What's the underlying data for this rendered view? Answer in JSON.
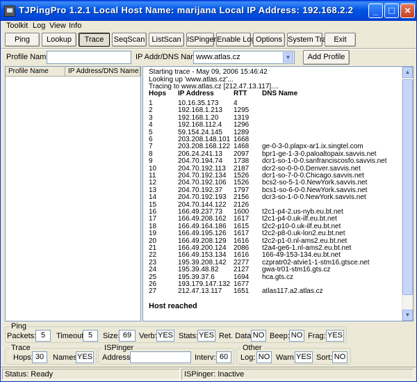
{
  "window": {
    "title": "TJPingPro 1.2.1  Local Host Name: marijana   Local IP Address: 192.168.2.2",
    "controls": {
      "minimize": "_",
      "maximize": "□",
      "close": "×"
    }
  },
  "menu": [
    "Toolkit",
    "Log",
    "View",
    "Info"
  ],
  "toolbar": [
    "Ping",
    "Lookup",
    "Trace",
    "SeqScan",
    "ListScan",
    "ISPinger",
    "Enable Log",
    "Options",
    "System Tray",
    "Exit"
  ],
  "toolbar_active": "Trace",
  "profile_bar": {
    "profile_label": "Profile Name:",
    "profile_value": "",
    "addr_label": "IP Addr/DNS Name:",
    "addr_value": "www.atlas.cz",
    "add_button": "Add Profile"
  },
  "profile_list": {
    "columns": [
      "Profile Name",
      "IP Address/DNS Name"
    ]
  },
  "output": {
    "intro": [
      "Starting trace - May 09, 2006  15:46:42",
      "Looking up 'www.atlas.cz'...",
      "Tracing to www.atlas.cz [212.47.13.117]...."
    ],
    "columns": [
      "Hops",
      "IP Address",
      "RTT",
      "DNS Name"
    ],
    "rows": [
      [
        "1",
        "10.16.35.173",
        "4",
        ""
      ],
      [
        "2",
        "192.168.1.213",
        "1295",
        ""
      ],
      [
        "3",
        "192.168.1.20",
        "1319",
        ""
      ],
      [
        "4",
        "192.168.112.4",
        "1296",
        ""
      ],
      [
        "5",
        "59.154.24.145",
        "1289",
        ""
      ],
      [
        "6",
        "203.208.148.101",
        "1668",
        ""
      ],
      [
        "7",
        "203.208.168.122",
        "1468",
        "ge-0-3-0.plapx-ar1.ix.singtel.com"
      ],
      [
        "8",
        "206.24.241.13",
        "2097",
        "bpr1-ge-1-3-0.paloaltopaix.savvis.net"
      ],
      [
        "9",
        "204.70.194.74",
        "1738",
        "dcr1-so-1-0-0.sanfranciscosfo.savvis.net"
      ],
      [
        "10",
        "204.70.192.113",
        "2187",
        "dcr2-so-0-0-0.Denver.savvis.net"
      ],
      [
        "11",
        "204.70.192.134",
        "1526",
        "dcr1-so-7-0-0.Chicago.savvis.net"
      ],
      [
        "12",
        "204.70.192.106",
        "1526",
        "bcs2-so-5-1-0.NewYork.savvis.net"
      ],
      [
        "13",
        "204.70.192.37",
        "1797",
        "bcs1-so-6-0-0.NewYork.savvis.net"
      ],
      [
        "14",
        "204.70.192.193",
        "2156",
        "dcr3-so-1-0-0.NewYork.savvis.net"
      ],
      [
        "15",
        "204.70.144.122",
        "2126",
        ""
      ],
      [
        "16",
        "166.49.237.73",
        "1600",
        "t2c1-p4-2.us-nyb.eu.bt.net"
      ],
      [
        "17",
        "166.49.208.162",
        "1617",
        "t2c1-p4-0.uk-ilf.eu.bt.net"
      ],
      [
        "18",
        "166.49.164.186",
        "1615",
        "t2c2-p10-0.uk-ilf.eu.bt.net"
      ],
      [
        "19",
        "166.49.195.126",
        "1617",
        "t2c2-p8-0.uk-lon2.eu.bt.net"
      ],
      [
        "20",
        "166.49.208.129",
        "1616",
        "t2c2-p1-0.nl-ams2.eu.bt.net"
      ],
      [
        "21",
        "166.49.200.124",
        "2086",
        "t2a4-ge6-1.nl-ams2.eu.bt.net"
      ],
      [
        "22",
        "166.49.153.134",
        "1616",
        "166-49-153-134.eu.bt.net"
      ],
      [
        "23",
        "195.39.208.142",
        "2277",
        "czpratr02-atvie1-1-stm16.gtsce.net"
      ],
      [
        "24",
        "195.39.48.82",
        "2127",
        "gwa-tr01-stm16.gts.cz"
      ],
      [
        "25",
        "195.39.37.6",
        "1694",
        "hca.gts.cz"
      ],
      [
        "26",
        "193.179.147.132",
        "1677",
        ""
      ],
      [
        "27",
        "212.47.13.117",
        "1651",
        "atlas117.a2.atlas.cz"
      ]
    ],
    "footer": "Host reached"
  },
  "ping": {
    "title": "Ping",
    "packets_label": "Packets:",
    "packets": "5",
    "timeout_label": "Timeout:",
    "timeout": "5",
    "size_label": "Size:",
    "size": "69",
    "verb_label": "Verb:",
    "verb": "YES",
    "stats_label": "Stats:",
    "stats": "YES",
    "retdata_label": "Ret. Data:",
    "retdata": "NO",
    "beep_label": "Beep:",
    "beep": "NO",
    "frag_label": "Frag:",
    "frag": "YES"
  },
  "trace": {
    "title": "Trace",
    "hops_label": "Hops:",
    "hops": "30",
    "names_label": "Names:",
    "names": "YES"
  },
  "ispinger": {
    "title": "ISPinger",
    "address_label": "Address:",
    "address": "",
    "interv_label": "Interv:",
    "interv": "60"
  },
  "other": {
    "title": "Other",
    "log_label": "Log:",
    "log": "NO",
    "warn_label": "Warn:",
    "warn": "YES",
    "sort_label": "Sort:",
    "sort": "NO"
  },
  "status": {
    "left": "Status: Ready",
    "right": "ISPinger: Inactive"
  },
  "colors": {
    "title_bar": "#0054e3",
    "face": "#ece9d8",
    "field_border": "#7f9db9"
  }
}
